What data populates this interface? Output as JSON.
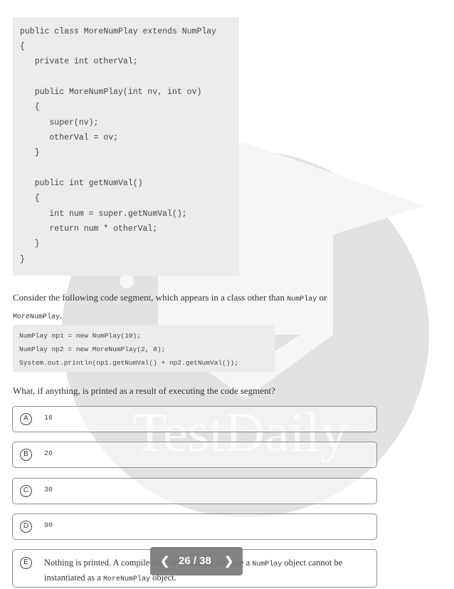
{
  "watermark": {
    "text": "TestDaily"
  },
  "class_code": [
    "public class MoreNumPlay extends NumPlay",
    "{",
    "   private int otherVal;",
    "",
    "   public MoreNumPlay(int nv, int ov)",
    "   {",
    "      super(nv);",
    "      otherVal = ov;",
    "   }",
    "",
    "   public int getNumVal()",
    "   {",
    "      int num = super.getNumVal();",
    "      return num * otherVal;",
    "   }",
    "}"
  ],
  "question": {
    "intro_text": "Consider the following code segment, which appears in a class other than ",
    "class1": "NumPlay",
    "or_text": " or",
    "class2": "MoreNumPlay",
    "period": "."
  },
  "segment_code": [
    "NumPlay np1 = new NumPlay(10);",
    "NumPlay np2 = new MoreNumPlay(2, 8);",
    "System.out.println(np1.getNumVal() + np2.getNumVal());"
  ],
  "prompt": "What, if anything, is printed as a result of executing the code segment?",
  "choices": [
    {
      "letter": "A",
      "text": "16"
    },
    {
      "letter": "B",
      "text": "26"
    },
    {
      "letter": "C",
      "text": "30"
    },
    {
      "letter": "D",
      "text": "90"
    }
  ],
  "choice_e": {
    "letter": "E",
    "part1": "Nothing is printed. A compile-time error occurs because a ",
    "code1": "NumPlay",
    "part2": " object cannot be instantiated as a ",
    "code2": "MoreNumPlay",
    "part3": " object."
  },
  "pager": {
    "prev_icon": "chevron-left-icon",
    "next_icon": "chevron-right-icon",
    "label": "26 / 38"
  }
}
